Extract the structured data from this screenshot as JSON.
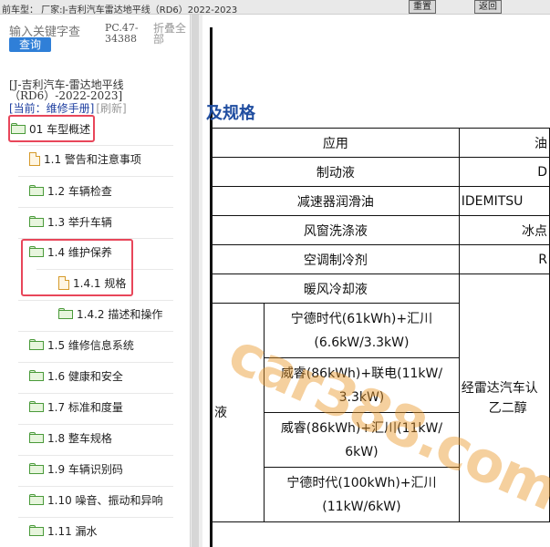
{
  "topbar": {
    "title": "前车型：  厂家:J-吉利汽车雷达地平线（RD6）2022-2023",
    "buttons": [
      "重置",
      "返回"
    ]
  },
  "sidebar": {
    "search_placeholder": "输入关键字查",
    "query_button": "查询",
    "pc_code": "PC.47-34388",
    "collapse_all": "折叠全部",
    "book_title": "[J-吉利汽车-雷达地平线（RD6）-2022-2023]",
    "current_label": "[当前：维修手册]",
    "refresh": "[刷新]",
    "tree": [
      {
        "label": "01 车型概述",
        "icon": "folder-icon"
      },
      {
        "label": "1.1 警告和注意事项",
        "icon": "document-icon"
      },
      {
        "label": "1.2 车辆检查",
        "icon": "folder-icon"
      },
      {
        "label": "1.3 举升车辆",
        "icon": "folder-icon"
      },
      {
        "label": "1.4 维护保养",
        "icon": "folder-icon"
      },
      {
        "label": "1.4.1 规格",
        "icon": "document-icon"
      },
      {
        "label": "1.4.2 描述和操作",
        "icon": "folder-icon"
      },
      {
        "label": "1.5 维修信息系统",
        "icon": "folder-icon"
      },
      {
        "label": "1.6 健康和安全",
        "icon": "folder-icon"
      },
      {
        "label": "1.7 标准和度量",
        "icon": "folder-icon"
      },
      {
        "label": "1.8 整车规格",
        "icon": "folder-icon"
      },
      {
        "label": "1.9 车辆识别码",
        "icon": "folder-icon"
      },
      {
        "label": "1.10 噪音、振动和异响",
        "icon": "folder-icon"
      },
      {
        "label": "1.11 漏水",
        "icon": "folder-icon"
      }
    ]
  },
  "document": {
    "section_title": "及规格",
    "table": {
      "header": {
        "col1": "应用",
        "col2": "油"
      },
      "rows": [
        {
          "name": "制动液",
          "value": "D"
        },
        {
          "name": "减速器润滑油",
          "value": "IDEMITSU"
        },
        {
          "name": "风窗洗涤液",
          "value": "冰点"
        },
        {
          "name": "空调制冷剂",
          "value": "R"
        },
        {
          "name": "暖风冷却液",
          "value": ""
        }
      ],
      "side_text": "液",
      "merged_value_lines": [
        "经雷达汽车认",
        "乙二醇"
      ],
      "sub_rows": [
        {
          "line1": "宁德时代(61kWh)+汇川",
          "line2": "(6.6kW/3.3kW)"
        },
        {
          "line1": "威睿(86kWh)+联电(11kW/",
          "line2": "3.3kW)"
        },
        {
          "line1": "威睿(86kWh)+汇川(11kW/",
          "line2": "6kW)"
        },
        {
          "line1": "宁德时代(100kWh)+汇川",
          "line2": "(11kW/6kW)"
        }
      ]
    }
  },
  "watermark": "car388.com",
  "colors": {
    "highlight": "#e8465a",
    "section_title": "#1f4da0",
    "query_button": "#2f7fd8",
    "folder": "#4a9a3a",
    "document": "#d59a2a"
  }
}
